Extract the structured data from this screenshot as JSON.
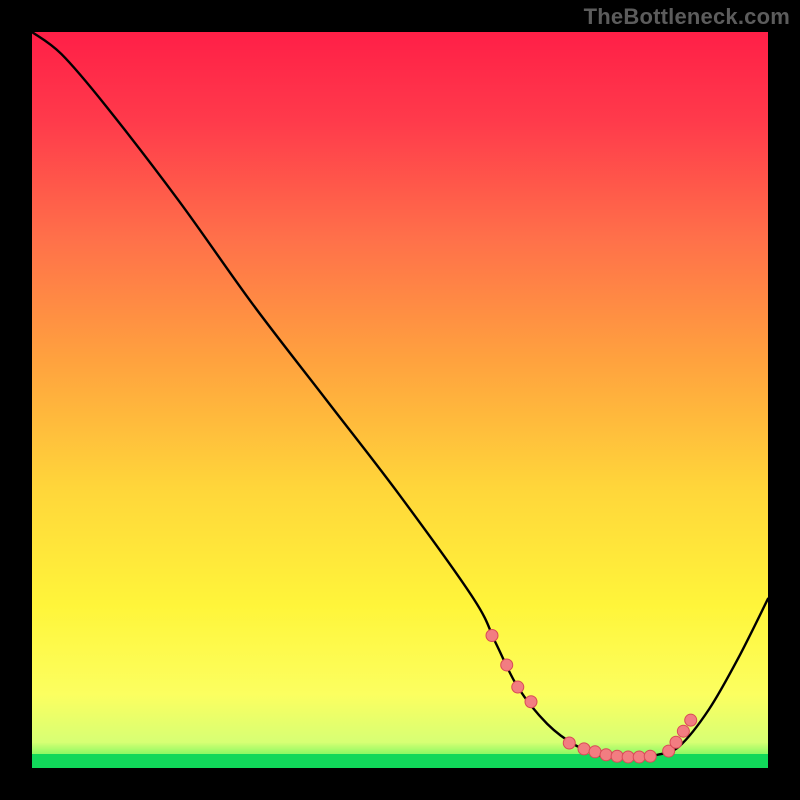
{
  "watermark": "TheBottleneck.com",
  "colors": {
    "frame": "#000000",
    "watermark": "#5c5c5c",
    "curve": "#000000",
    "marker_fill": "#f27d81",
    "marker_stroke": "#d94a57",
    "green_band": "#11d85a",
    "gradient_stops": [
      {
        "offset": 0.0,
        "color": "#ff1f47"
      },
      {
        "offset": 0.12,
        "color": "#ff3a4b"
      },
      {
        "offset": 0.28,
        "color": "#ff704a"
      },
      {
        "offset": 0.45,
        "color": "#ffa33e"
      },
      {
        "offset": 0.62,
        "color": "#ffd63a"
      },
      {
        "offset": 0.78,
        "color": "#fff53a"
      },
      {
        "offset": 0.9,
        "color": "#fcff60"
      },
      {
        "offset": 0.965,
        "color": "#d7ff74"
      },
      {
        "offset": 0.985,
        "color": "#7af75f"
      },
      {
        "offset": 1.0,
        "color": "#11d85a"
      }
    ]
  },
  "chart_data": {
    "type": "line",
    "title": "",
    "xlabel": "",
    "ylabel": "",
    "x_range": [
      0,
      100
    ],
    "y_range": [
      0,
      100
    ],
    "grid": false,
    "series": [
      {
        "name": "bottleneck-curve",
        "x": [
          0,
          4,
          10,
          20,
          30,
          40,
          50,
          60,
          63,
          66,
          70,
          74,
          78,
          82,
          85,
          88,
          92,
          96,
          100
        ],
        "y": [
          100,
          97,
          90,
          77,
          63,
          50,
          37,
          23,
          17,
          11,
          6,
          3,
          1.5,
          1.5,
          1.8,
          3,
          8,
          15,
          23
        ]
      }
    ],
    "markers": {
      "name": "highlight-points",
      "x": [
        62.5,
        64.5,
        66.0,
        67.8,
        73.0,
        75.0,
        76.5,
        78.0,
        79.5,
        81.0,
        82.5,
        84.0,
        86.5,
        87.5,
        88.5,
        89.5
      ],
      "y": [
        18.0,
        14.0,
        11.0,
        9.0,
        3.4,
        2.6,
        2.2,
        1.8,
        1.6,
        1.5,
        1.5,
        1.6,
        2.3,
        3.5,
        5.0,
        6.5
      ]
    }
  }
}
